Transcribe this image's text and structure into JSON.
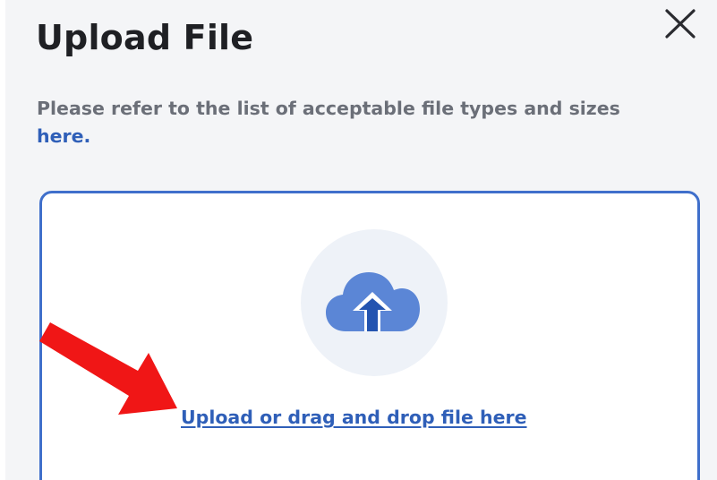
{
  "dialog": {
    "title": "Upload File",
    "close_icon": "close-icon",
    "description_text": "Please refer to the list of acceptable file types and sizes",
    "description_link": "here.",
    "dropzone": {
      "icon": "cloud-upload-icon",
      "link_text": "Upload or drag and drop file here"
    }
  },
  "annotation": {
    "icon": "red-arrow-icon",
    "color": "#f01616"
  },
  "colors": {
    "accent": "#3f6fcb",
    "link": "#2f5fb8",
    "title": "#1f2024",
    "muted_text": "#6b6f78",
    "dialog_bg": "#f4f5f7"
  }
}
